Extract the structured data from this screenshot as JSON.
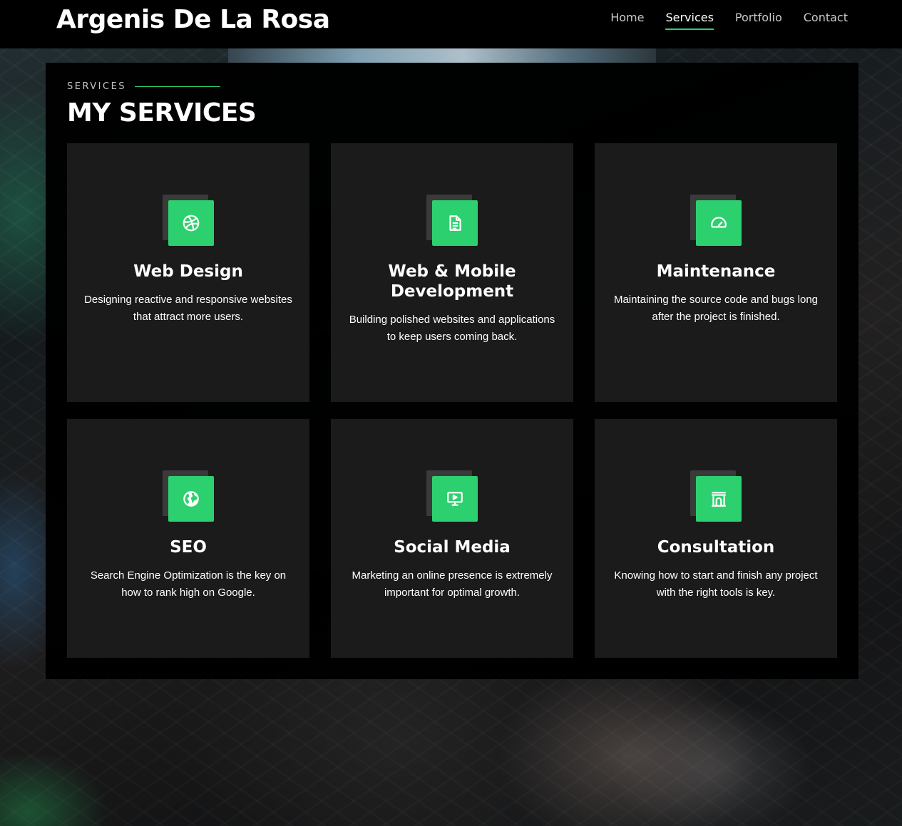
{
  "nav": {
    "brand": "Argenis De La Rosa",
    "links": [
      {
        "label": "Home",
        "active": false
      },
      {
        "label": "Services",
        "active": true
      },
      {
        "label": "Portfolio",
        "active": false
      },
      {
        "label": "Contact",
        "active": false
      }
    ]
  },
  "section": {
    "tag": "SERVICES",
    "title": "MY SERVICES"
  },
  "services": [
    {
      "icon": "dribbble-icon",
      "title": "Web Design",
      "description": "Designing reactive and responsive websites that attract more users."
    },
    {
      "icon": "document-icon",
      "title": "Web & Mobile Development",
      "description": "Building polished websites and applications to keep users coming back."
    },
    {
      "icon": "dashboard-gauge-icon",
      "title": "Maintenance",
      "description": "Maintaining the source code and bugs long after the project is finished."
    },
    {
      "icon": "globe-icon",
      "title": "SEO",
      "description": "Search Engine Optimization is the key on how to rank high on Google."
    },
    {
      "icon": "presentation-screen-icon",
      "title": "Social Media",
      "description": "Marketing an online presence is extremely important for optimal growth."
    },
    {
      "icon": "archway-icon",
      "title": "Consultation",
      "description": "Knowing how to start and finish any project with the right tools is key."
    }
  ],
  "colors": {
    "accent": "#2dd06e",
    "navbar": "#000000",
    "panel": "#000000",
    "card": "#1b1b1b"
  }
}
